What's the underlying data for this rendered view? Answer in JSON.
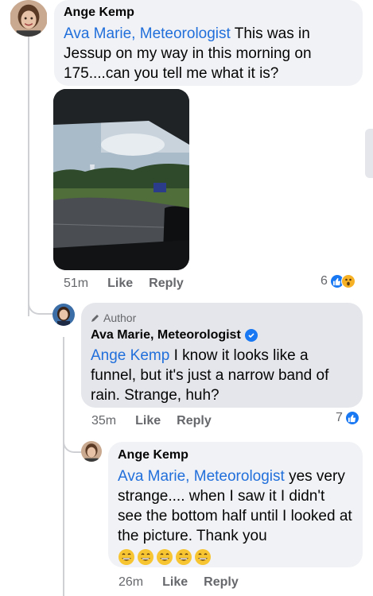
{
  "comments": [
    {
      "author": "Ange Kemp",
      "mention": "Ava Marie, Meteorologist",
      "text": " This was in Jessup on my way in this morning on 175....can you tell me what it is?",
      "time": "51m",
      "like_label": "Like",
      "reply_label": "Reply",
      "reaction_count": "6",
      "reactions": [
        "like-icon",
        "wow-icon"
      ],
      "has_photo": true
    },
    {
      "author_tag": "Author",
      "author": "Ava Marie, Meteorologist",
      "verified": true,
      "mention": "Ange Kemp",
      "text": " I know it looks like a funnel, but it's just a narrow band of rain. Strange, huh?",
      "time": "35m",
      "like_label": "Like",
      "reply_label": "Reply",
      "reaction_count": "7",
      "reactions": [
        "like-icon"
      ]
    },
    {
      "author": "Ange Kemp",
      "mention": "Ava Marie, Meteorologist",
      "text": " yes very strange.... when I saw it I didn't see the bottom half until I looked at the picture. Thank you",
      "emoji": [
        "grinning-face-icon",
        "grinning-face-icon",
        "grinning-face-icon",
        "grinning-face-icon",
        "grinning-face-icon"
      ],
      "time": "26m",
      "like_label": "Like",
      "reply_label": "Reply"
    }
  ],
  "colors": {
    "mention": "#216fdb",
    "bubble": "#f0f2f5",
    "meta": "#65676b",
    "like": "#1877f2"
  }
}
